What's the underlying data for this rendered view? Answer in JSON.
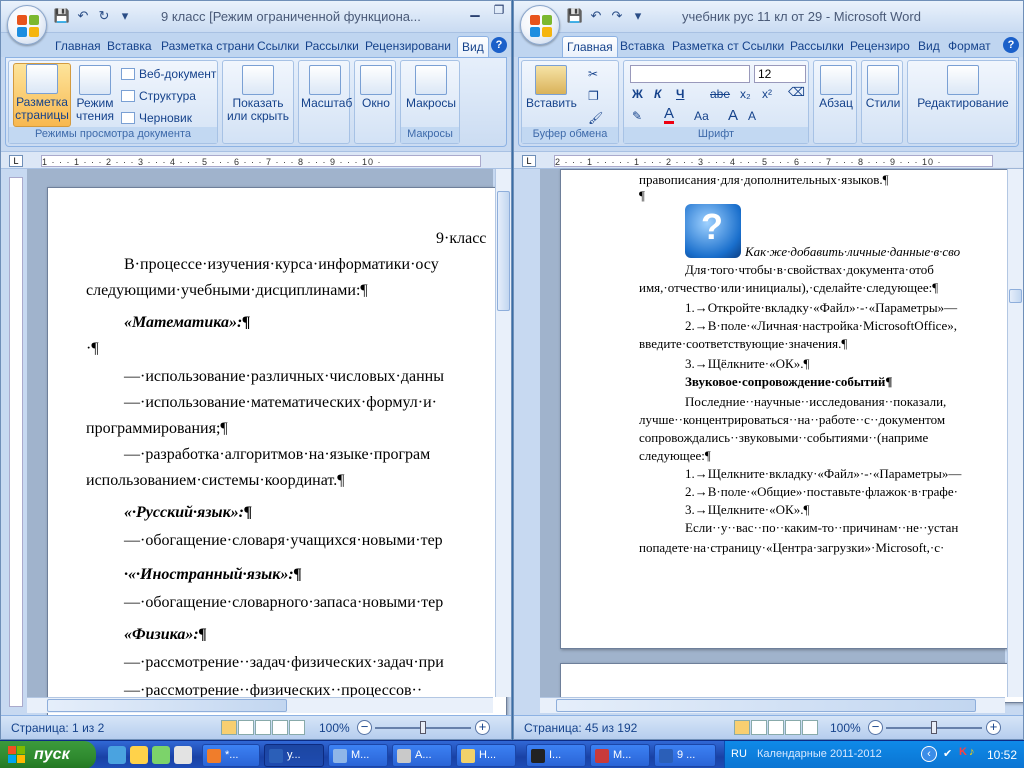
{
  "left_window": {
    "title": "9 класс [Режим ограниченной функциона...",
    "tabs": [
      "Главная",
      "Вставка",
      "Разметка страни",
      "Ссылки",
      "Рассылки",
      "Рецензировани",
      "Вид"
    ],
    "active_tab": "Вид",
    "ribbon": {
      "view_modes_group": "Режимы просмотра документа",
      "print_layout": "Разметка страницы",
      "reading": "Режим чтения",
      "web_doc": "Веб-документ",
      "outline": "Структура",
      "draft": "Черновик",
      "show_hide": "Показать или скрыть",
      "zoom": "Масштаб",
      "window": "Окно",
      "macros": "Макросы",
      "macros_group": "Макросы"
    },
    "ruler_numbers": "1 · · · 1 · · · 2 · · · 3 · · · 4 · · · 5 · · · 6 · · · 7 · · · 8 · · · 9 · · · 10 ·",
    "document": {
      "lines": [
        "9·класс",
        "В·процессе·изучения·курса·информатики·осу",
        "следующими·учебными·дисциплинами:¶",
        "«Математика»:¶",
        "·¶",
        "—·использование·различных·числовых·данны",
        "—·использование·математических·формул·и·",
        "программирования;¶",
        "—·разработка·алгоритмов·на·языке·програм",
        "использованием·системы·координат.¶",
        "«·Русский·язык»:¶",
        "—·обогащение·словаря·учащихся·новыми·тер",
        "·«·Иностранный·язык»:¶",
        "—·обогащение·словарного·запаса·новыми·тер",
        "«Физика»:¶",
        "—·рассмотрение··задач·физических·задач·при",
        "—·рассмотрение··физических··процессов··"
      ]
    },
    "status": {
      "page": "Страница: 1 из 2",
      "zoom": "100%"
    }
  },
  "right_window": {
    "title": "учебник рус 11 кл от 29 - Microsoft Word",
    "tabs": [
      "Главная",
      "Вставка",
      "Разметка ст",
      "Ссылки",
      "Рассылки",
      "Рецензиро",
      "Вид",
      "Формат"
    ],
    "active_tab": "Главная",
    "ribbon": {
      "paste": "Вставить",
      "clipboard_group": "Буфер обмена",
      "font_name": "",
      "font_size": "12",
      "bold": "Ж",
      "italic": "К",
      "underline": "Ч",
      "strike": "abe",
      "subscript": "x₂",
      "superscript": "x²",
      "font_color": "А",
      "case": "Аа",
      "grow": "А",
      "shrink": "А",
      "font_group": "Шрифт",
      "paragraph": "Абзац",
      "styles": "Стили",
      "editing": "Редактирование"
    },
    "ruler_numbers": "2 · · · 1 · · · · · 1 · · · 2 · · · 3 · · · 4 · · · 5 · · · 6 · · · 7 · · · 8 · · · 9 · · · 10 ·",
    "document": {
      "lines": [
        "правописания·для·дополнительных·языков.¶",
        "¶",
        "Как·же·добавить·личные·данные·в·сво",
        "Для·того·чтобы·в·свойствах·документа·отоб",
        "имя,·отчество·или·инициалы),·сделайте·следующее:¶",
        "1.→Откройте·вкладку·«Файл»·-·«Параметры»—",
        "2.→В·поле·«Личная·настройка·MicrosoftOffice»,",
        "введите·соответствующие·значения.¶",
        "3.→Щёлкните·«ОК».¶",
        "Звуковое·сопровождение·событий¶",
        "Последние··научные··исследования··показали,",
        "лучше··концентрироваться··на··работе··с··документом",
        "сопровождались··звуковыми··событиями··(наприме",
        "следующее:¶",
        "1.→Щелкните·вкладку·«Файл»·-·«Параметры»—",
        "2.→В·поле·«Общие»·поставьте·флажок·в·графе·",
        "3.→Щелкните·«ОК».¶",
        "Если··у··вас··по··каким-то··причинам··не··устан",
        "попадете·на·страницу·«Центра·загрузки»·Microsoft,·с·"
      ]
    },
    "status": {
      "page": "Страница: 45 из 192",
      "zoom": "100%"
    }
  },
  "taskbar": {
    "start": "пуск",
    "buttons": [
      "*...",
      "у...",
      "М...",
      "А...",
      "Н...",
      "I...",
      "М...",
      "9 ..."
    ],
    "lang": "RU",
    "calendar": "Календарные 2011-2012",
    "clock": "10:52"
  },
  "colors": {
    "ribbon_text": "#15428b",
    "taskbar": "#245edb",
    "start": "#2f8a2f"
  }
}
